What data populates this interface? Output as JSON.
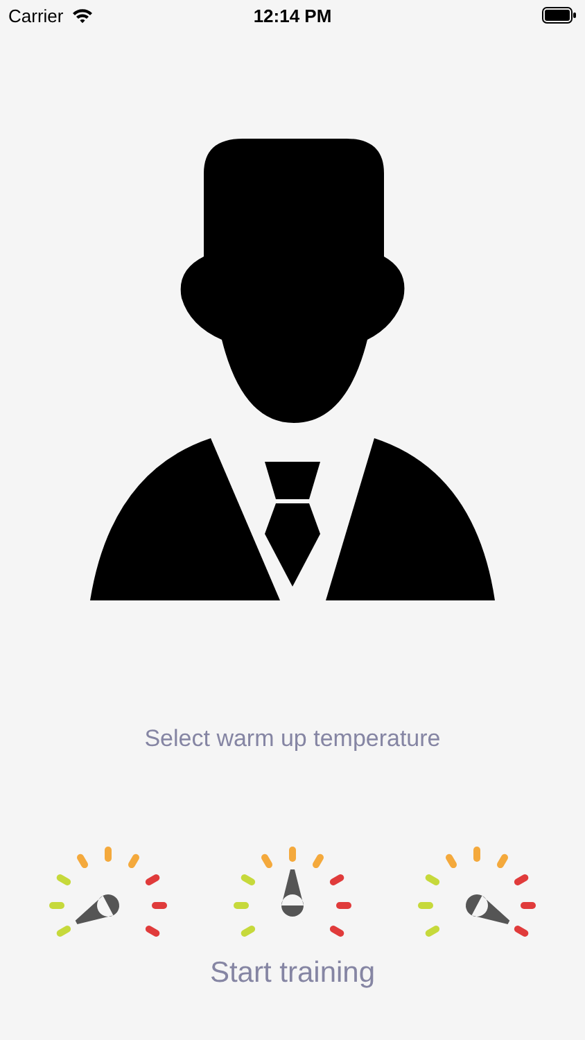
{
  "status_bar": {
    "carrier": "Carrier",
    "time": "12:14 PM"
  },
  "prompt": "Select warm up temperature",
  "gauges": [
    {
      "kind": "low",
      "selected": false
    },
    {
      "kind": "medium",
      "selected": false
    },
    {
      "kind": "high",
      "selected": false
    }
  ],
  "start_button": "Start training"
}
